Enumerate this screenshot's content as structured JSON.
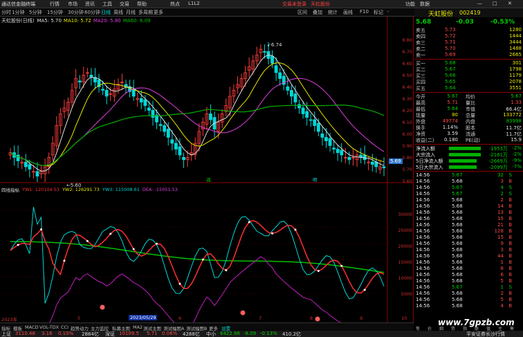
{
  "app": {
    "title": "通达信金融终端",
    "menu": [
      "行情",
      "市场",
      "资讯",
      "工具",
      "交易",
      "帮助",
      "热点",
      "L1L2"
    ],
    "promo": "交易未登录",
    "promo2": "天虹股份",
    "right_menu": [
      "功能",
      "数据"
    ]
  },
  "toolbar": {
    "items": [
      "分时",
      "1分钟",
      "5分钟",
      "15分钟",
      "30分钟",
      "60分钟",
      "日线",
      "周线",
      "月线",
      "多周期",
      "更多"
    ],
    "selected": "日线",
    "right": [
      "区间",
      "叠加",
      "统计",
      "画线",
      "F10",
      "标记",
      "-"
    ]
  },
  "chart": {
    "title": "天虹股份(日线)",
    "ma_legend": [
      {
        "name": "MA5",
        "value": "5.70",
        "color": "#e0e0e0"
      },
      {
        "name": "MA10",
        "value": "5.72",
        "color": "#e8e800"
      },
      {
        "name": "MA20",
        "value": "5.80",
        "color": "#e040e0"
      },
      {
        "name": "MA60",
        "value": "6.09",
        "color": "#00c000"
      }
    ],
    "y_ticks": [
      "6.80",
      "6.70",
      "6.60",
      "6.50",
      "6.40",
      "6.30",
      "6.20",
      "6.10",
      "6.00",
      "5.90",
      "5.80",
      "5.70",
      "5.60"
    ],
    "high_label": "6.74",
    "low_label": "5.60",
    "current_price": "5.69",
    "month_labels": [
      "减",
      "明"
    ]
  },
  "indicator": {
    "title": "四线指标",
    "values": [
      {
        "name": "YW1",
        "value": "120104.53",
        "color": "#ff3030"
      },
      {
        "name": "YW2",
        "value": "126291.73",
        "color": "#e8e800"
      },
      {
        "name": "YW3",
        "value": "115008.61",
        "color": "#00d8d8"
      },
      {
        "name": "DEA",
        "value": "-15051.53",
        "color": "#e040e0"
      }
    ],
    "y_ticks": [
      "30000",
      "25000",
      "20000",
      "15000",
      "10000",
      "5000"
    ]
  },
  "xaxis": {
    "labels": [
      "2023年",
      "5",
      "2023/05/29",
      "6",
      "7",
      "8",
      "9",
      "10"
    ]
  },
  "tabs": [
    "指标",
    "模板",
    "MACD",
    "VOL-TDX",
    "CCI",
    "趋势动力",
    "主力监控",
    "私募主图",
    "MA2",
    "测试主图",
    "测试幅图A",
    "测试幅图B",
    "更多",
    "设置"
  ],
  "panel": {
    "name": "天虹股份",
    "code": "002419",
    "price": "5.68",
    "change": "-0.03",
    "pct": "-0.53%",
    "asks": [
      {
        "l": "卖五",
        "p": "5.73",
        "v": "1280"
      },
      {
        "l": "卖四",
        "p": "5.72",
        "v": "1444"
      },
      {
        "l": "卖三",
        "p": "5.71",
        "v": "3444"
      },
      {
        "l": "卖二",
        "p": "5.70",
        "v": "1488"
      },
      {
        "l": "卖一",
        "p": "5.69",
        "v": "2665"
      }
    ],
    "bids": [
      {
        "l": "买一",
        "p": "5.68",
        "v": "301"
      },
      {
        "l": "买二",
        "p": "5.67",
        "v": "1798"
      },
      {
        "l": "买三",
        "p": "5.66",
        "v": "1179"
      },
      {
        "l": "买四",
        "p": "5.65",
        "v": "2078"
      },
      {
        "l": "买五",
        "p": "5.64",
        "v": "3551"
      }
    ],
    "stats": [
      {
        "l1": "今开",
        "v1": "5.67",
        "l2": "均价",
        "v2": "5.67"
      },
      {
        "l1": "最高",
        "v1": "5.71",
        "l2": "量比",
        "v2": "1.33"
      },
      {
        "l1": "最低",
        "v1": "5.64",
        "l2": "市值",
        "v2": "66.4亿"
      },
      {
        "l1": "现量",
        "v1": "80",
        "l2": "总量",
        "v2": "133772"
      },
      {
        "l1": "外盘",
        "v1": "49774",
        "l2": "内盘",
        "v2": "83998"
      },
      {
        "l1": "换手",
        "v1": "1.14%",
        "l2": "股本",
        "v2": "11.7亿"
      },
      {
        "l1": "净资",
        "v1": "3.59",
        "l2": "流通",
        "v2": "11.7亿"
      },
      {
        "l1": "收益(二)",
        "v1": "0.180",
        "l2": "PE(动)",
        "v2": "15.9"
      }
    ],
    "flows": [
      {
        "l": "净流入额",
        "v": "-1953万",
        "p": "-2%"
      },
      {
        "l": "大宗流入",
        "v": "-2161万",
        "p": "-2%"
      },
      {
        "l": "5日净流入额",
        "v": "-2669万",
        "p": "-9%"
      },
      {
        "l": "5日大宗流入",
        "v": "-2099万",
        "p": "-7%"
      }
    ],
    "ticks": [
      {
        "t": "14:56",
        "p": "5.67",
        "v": "32",
        "d": "S"
      },
      {
        "t": "14:56",
        "p": "5.68",
        "v": "3",
        "d": "B"
      },
      {
        "t": "14:56",
        "p": "5.67",
        "v": "4",
        "d": "S"
      },
      {
        "t": "14:56",
        "p": "5.67",
        "v": "2",
        "d": "S"
      },
      {
        "t": "14:56",
        "p": "5.68",
        "v": "2",
        "d": "B"
      },
      {
        "t": "14:56",
        "p": "5.68",
        "v": "14",
        "d": "B"
      },
      {
        "t": "14:56",
        "p": "5.68",
        "v": "13",
        "d": "B"
      },
      {
        "t": "14:56",
        "p": "5.68",
        "v": "15",
        "d": "B"
      },
      {
        "t": "14:56",
        "p": "5.68",
        "v": "21",
        "d": "B"
      },
      {
        "t": "14:56",
        "p": "5.68",
        "v": "128",
        "d": "B"
      },
      {
        "t": "14:56",
        "p": "5.68",
        "v": "15",
        "d": "B"
      },
      {
        "t": "14:56",
        "p": "5.68",
        "v": "9",
        "d": "B"
      },
      {
        "t": "14:56",
        "p": "5.68",
        "v": "3",
        "d": "B"
      },
      {
        "t": "14:56",
        "p": "5.68",
        "v": "44",
        "d": "B"
      },
      {
        "t": "14:56",
        "p": "5.68",
        "v": "1",
        "d": "B"
      },
      {
        "t": "14:56",
        "p": "5.68",
        "v": "6",
        "d": "B"
      },
      {
        "t": "14:56",
        "p": "5.68",
        "v": "6",
        "d": "B"
      },
      {
        "t": "14:56",
        "p": "5.68",
        "v": "5",
        "d": "B"
      },
      {
        "t": "14:56",
        "p": "5.67",
        "v": "1",
        "d": "S"
      },
      {
        "t": "14:56",
        "p": "5.68",
        "v": "2",
        "d": "B"
      },
      {
        "t": "14:56",
        "p": "5.68",
        "v": "5",
        "d": "B"
      },
      {
        "t": "14:56",
        "p": "5.68",
        "v": "4",
        "d": "B"
      }
    ],
    "subtabs": [
      "笔",
      "价",
      "细",
      "势",
      "指",
      "联",
      "值",
      "主",
      "筹"
    ]
  },
  "status": {
    "items": [
      {
        "l": "上证",
        "v": "3110.48",
        "c": "3.16",
        "p": "0.10%",
        "a": "2884亿"
      },
      {
        "l": "深证",
        "v": "10109.5",
        "c": "5.71",
        "p": "0.06%",
        "a": "4288亿"
      },
      {
        "l": "中小",
        "v": "6422.96",
        "c": "-8.09",
        "p": "-0.13%",
        "a": "410.2亿"
      }
    ],
    "right": "平安证券长沙行情"
  },
  "watermark": "www.7gpzb.com"
}
